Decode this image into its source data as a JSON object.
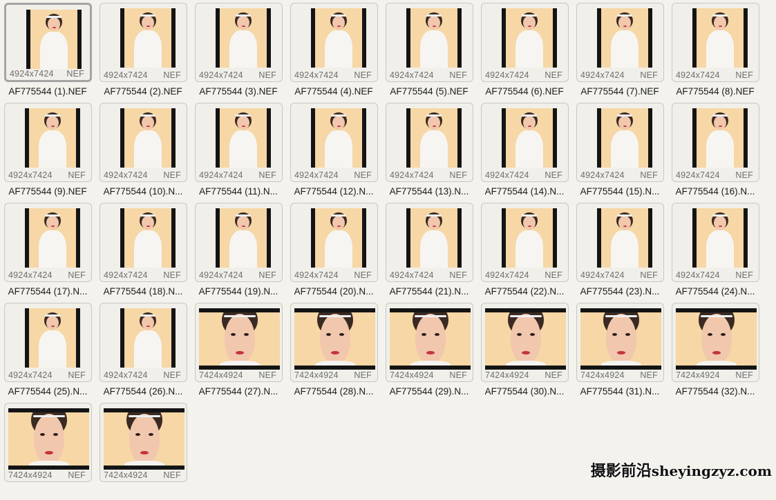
{
  "files": [
    {
      "name": "AF775544 (1).NEF",
      "dims": "4924x7424",
      "ext": "NEF",
      "orientation": "portrait",
      "selected": true
    },
    {
      "name": "AF775544 (2).NEF",
      "dims": "4924x7424",
      "ext": "NEF",
      "orientation": "portrait"
    },
    {
      "name": "AF775544 (3).NEF",
      "dims": "4924x7424",
      "ext": "NEF",
      "orientation": "portrait"
    },
    {
      "name": "AF775544 (4).NEF",
      "dims": "4924x7424",
      "ext": "NEF",
      "orientation": "portrait"
    },
    {
      "name": "AF775544 (5).NEF",
      "dims": "4924x7424",
      "ext": "NEF",
      "orientation": "portrait"
    },
    {
      "name": "AF775544 (6).NEF",
      "dims": "4924x7424",
      "ext": "NEF",
      "orientation": "portrait"
    },
    {
      "name": "AF775544 (7).NEF",
      "dims": "4924x7424",
      "ext": "NEF",
      "orientation": "portrait"
    },
    {
      "name": "AF775544 (8).NEF",
      "dims": "4924x7424",
      "ext": "NEF",
      "orientation": "portrait"
    },
    {
      "name": "AF775544 (9).NEF",
      "dims": "4924x7424",
      "ext": "NEF",
      "orientation": "portrait"
    },
    {
      "name": "AF775544 (10).N...",
      "dims": "4924x7424",
      "ext": "NEF",
      "orientation": "portrait"
    },
    {
      "name": "AF775544 (11).N...",
      "dims": "4924x7424",
      "ext": "NEF",
      "orientation": "portrait"
    },
    {
      "name": "AF775544 (12).N...",
      "dims": "4924x7424",
      "ext": "NEF",
      "orientation": "portrait"
    },
    {
      "name": "AF775544 (13).N...",
      "dims": "4924x7424",
      "ext": "NEF",
      "orientation": "portrait"
    },
    {
      "name": "AF775544 (14).N...",
      "dims": "4924x7424",
      "ext": "NEF",
      "orientation": "portrait"
    },
    {
      "name": "AF775544 (15).N...",
      "dims": "4924x7424",
      "ext": "NEF",
      "orientation": "portrait"
    },
    {
      "name": "AF775544 (16).N...",
      "dims": "4924x7424",
      "ext": "NEF",
      "orientation": "portrait"
    },
    {
      "name": "AF775544 (17).N...",
      "dims": "4924x7424",
      "ext": "NEF",
      "orientation": "portrait"
    },
    {
      "name": "AF775544 (18).N...",
      "dims": "4924x7424",
      "ext": "NEF",
      "orientation": "portrait"
    },
    {
      "name": "AF775544 (19).N...",
      "dims": "4924x7424",
      "ext": "NEF",
      "orientation": "portrait"
    },
    {
      "name": "AF775544 (20).N...",
      "dims": "4924x7424",
      "ext": "NEF",
      "orientation": "portrait"
    },
    {
      "name": "AF775544 (21).N...",
      "dims": "4924x7424",
      "ext": "NEF",
      "orientation": "portrait"
    },
    {
      "name": "AF775544 (22).N...",
      "dims": "4924x7424",
      "ext": "NEF",
      "orientation": "portrait"
    },
    {
      "name": "AF775544 (23).N...",
      "dims": "4924x7424",
      "ext": "NEF",
      "orientation": "portrait"
    },
    {
      "name": "AF775544 (24).N...",
      "dims": "4924x7424",
      "ext": "NEF",
      "orientation": "portrait"
    },
    {
      "name": "AF775544 (25).N...",
      "dims": "4924x7424",
      "ext": "NEF",
      "orientation": "portrait"
    },
    {
      "name": "AF775544 (26).N...",
      "dims": "4924x7424",
      "ext": "NEF",
      "orientation": "portrait"
    },
    {
      "name": "AF775544 (27).N...",
      "dims": "7424x4924",
      "ext": "NEF",
      "orientation": "landscape"
    },
    {
      "name": "AF775544 (28).N...",
      "dims": "7424x4924",
      "ext": "NEF",
      "orientation": "landscape"
    },
    {
      "name": "AF775544 (29).N...",
      "dims": "7424x4924",
      "ext": "NEF",
      "orientation": "landscape"
    },
    {
      "name": "AF775544 (30).N...",
      "dims": "7424x4924",
      "ext": "NEF",
      "orientation": "landscape"
    },
    {
      "name": "AF775544 (31).N...",
      "dims": "7424x4924",
      "ext": "NEF",
      "orientation": "landscape"
    },
    {
      "name": "AF775544 (32).N...",
      "dims": "7424x4924",
      "ext": "NEF",
      "orientation": "landscape"
    },
    {
      "name": "",
      "dims": "7424x4924",
      "ext": "NEF",
      "orientation": "landscape"
    },
    {
      "name": "",
      "dims": "7424x4924",
      "ext": "NEF",
      "orientation": "landscape"
    }
  ],
  "watermark": {
    "cjk": "摄影前沿",
    "latin": "sheyingzyz.com"
  },
  "colors": {
    "background": "#f3f2ec",
    "photo_backdrop": "#f6d7a5",
    "letterbox": "#141414"
  }
}
